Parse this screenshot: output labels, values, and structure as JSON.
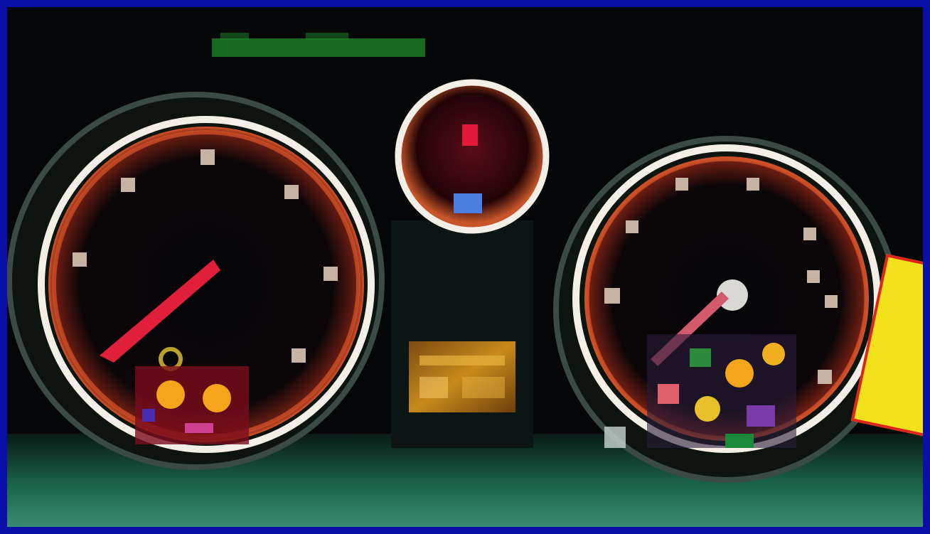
{
  "photo": {
    "subject": "instrument-cluster",
    "colors": {
      "border": "#0a0fa8",
      "background": "#040608",
      "gauge_ring": "#f4efe6",
      "glow": "#d9552a",
      "needle": "#e0203a",
      "warning_amber": "#f5a51a",
      "lcd": "#c98a1c",
      "top_text": "#1d8a2a",
      "dash_green": "#2ec07a",
      "sticker": "#f2e21c"
    },
    "icons": [
      "tachometer-gauge",
      "center-gauge",
      "speedometer-gauge",
      "warning-lights",
      "lcd-display",
      "sticker-label"
    ]
  }
}
